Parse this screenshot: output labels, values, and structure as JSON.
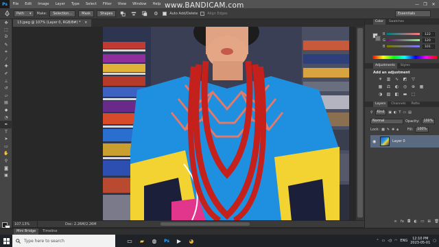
{
  "app": {
    "logo": "Ps",
    "menu": [
      "File",
      "Edit",
      "Image",
      "Layer",
      "Type",
      "Select",
      "Filter",
      "View",
      "Window",
      "Help"
    ],
    "window_controls": [
      "—",
      "❐",
      "✕"
    ]
  },
  "overlay": {
    "watermark": "www.BANDICAM.com"
  },
  "options_bar": {
    "mode_value": "Path",
    "make_label": "Make:",
    "selection_button": "Selection...",
    "mask_button": "Mask",
    "shapes_button": "Shapes",
    "auto_add_delete": "Auto Add/Delete",
    "auto_add_delete_checked": true,
    "align_edges": "Align Edges",
    "align_edges_checked": false,
    "workspace": "Essentials"
  },
  "document": {
    "tab_title": "13.jpeg @ 107% (Layer 0, RGB/8#) *",
    "tab_close": "×",
    "zoom": "107.13%",
    "doc_info": "Doc: 2.26M/2.26M"
  },
  "bottom_tabs": [
    "Mini Bridge",
    "Timeline"
  ],
  "color_panel": {
    "tabs": [
      "Color",
      "Swatches"
    ],
    "sliders": [
      {
        "letter": "R",
        "value": "122",
        "from": "#00797e",
        "to": "#ff797e"
      },
      {
        "letter": "G",
        "value": "120",
        "from": "#7a007e",
        "to": "#7aff7e"
      },
      {
        "letter": "B",
        "value": "101",
        "from": "#7a7900",
        "to": "#7a79ff"
      }
    ]
  },
  "adjustments_panel": {
    "tabs": [
      "Adjustments",
      "Styles"
    ],
    "title": "Add an adjustment"
  },
  "layers_panel": {
    "tabs": [
      "Layers",
      "Channels",
      "Paths"
    ],
    "filter_kind": "Kind",
    "blend_mode": "Normal",
    "opacity_label": "Opacity:",
    "opacity_value": "100%",
    "lock_label": "Lock:",
    "fill_label": "Fill:",
    "fill_value": "100%",
    "layers": [
      {
        "name": "Layer 0",
        "visible": true
      }
    ]
  },
  "taskbar": {
    "search_placeholder": "Type here to search",
    "language": "ENG",
    "time": "12:10 PM",
    "date": "2023-05-01"
  }
}
